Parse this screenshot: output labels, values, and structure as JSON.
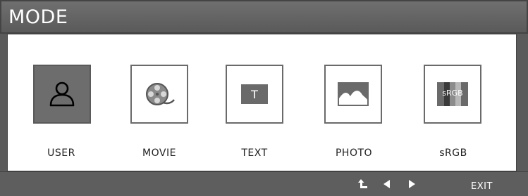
{
  "window": {
    "title": "MODE"
  },
  "modes": [
    {
      "label": "USER",
      "icon": "user-icon",
      "selected": true
    },
    {
      "label": "MOVIE",
      "icon": "film-reel-icon",
      "selected": false
    },
    {
      "label": "TEXT",
      "icon": "text-icon",
      "icon_text": "T",
      "selected": false
    },
    {
      "label": "PHOTO",
      "icon": "photo-icon",
      "selected": false
    },
    {
      "label": "sRGB",
      "icon": "srgb-icon",
      "icon_text": "sRGB",
      "selected": false
    }
  ],
  "bottom_bar": {
    "back_icon": "return-arrow-icon",
    "left_icon": "left-arrow-icon",
    "right_icon": "right-arrow-icon",
    "exit_label": "EXIT"
  },
  "colors": {
    "frame": "#5e5e5e",
    "selected_tile": "#6d6d6d",
    "text": "#222222"
  }
}
